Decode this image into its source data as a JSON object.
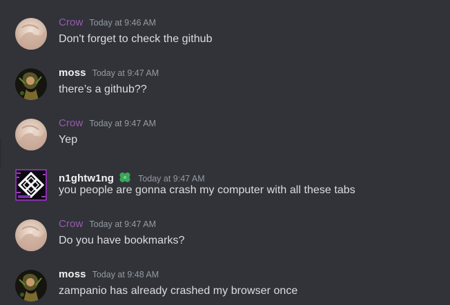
{
  "colors": {
    "background": "#313338",
    "message_text": "#dbdee1",
    "timestamp": "#949ba4",
    "crow_name": "#9b59b6",
    "default_name": "#f2f3f5",
    "badge_green": "#3ba55c"
  },
  "messages": [
    {
      "author": "Crow",
      "author_color": "#9b59b6",
      "timestamp": "Today at 9:46 AM",
      "text": "Don't forget to check the github",
      "avatar": "crow-avatar"
    },
    {
      "author": "moss",
      "author_color": "#f2f3f5",
      "timestamp": "Today at 9:47 AM",
      "text": "there’s a github??",
      "avatar": "moss-avatar"
    },
    {
      "author": "Crow",
      "author_color": "#9b59b6",
      "timestamp": "Today at 9:47 AM",
      "text": "Yep",
      "avatar": "crow-avatar"
    },
    {
      "author": "n1ghtw1ng",
      "author_color": "#f2f3f5",
      "timestamp": "Today at 9:47 AM",
      "text": "you people are gonna crash my computer with all these tabs",
      "avatar": "nightwing-avatar",
      "badge": "clover-icon"
    },
    {
      "author": "Crow",
      "author_color": "#9b59b6",
      "timestamp": "Today at 9:47 AM",
      "text": "Do you have bookmarks?",
      "avatar": "crow-avatar"
    },
    {
      "author": "moss",
      "author_color": "#f2f3f5",
      "timestamp": "Today at 9:48 AM",
      "text": "zampanio has already crashed my browser once",
      "avatar": "moss-avatar"
    }
  ]
}
